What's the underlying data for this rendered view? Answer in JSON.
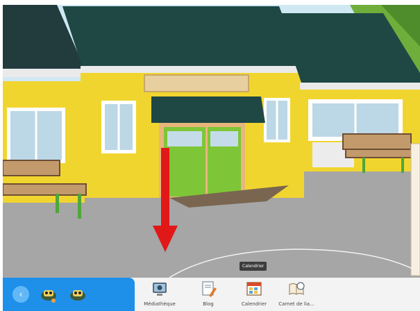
{
  "tooltip": {
    "text": "Calendrier"
  },
  "dock": {
    "back_icon": "chevron-left-icon",
    "characters": [
      "character-icon",
      "character-icon"
    ],
    "items": [
      {
        "label": "Médiathèque",
        "icon": "media-library-icon"
      },
      {
        "label": "Blog",
        "icon": "blog-icon"
      },
      {
        "label": "Calendrier",
        "icon": "calendar-icon"
      },
      {
        "label": "Carnet de lia...",
        "icon": "notebook-icon"
      }
    ]
  },
  "colors": {
    "dock_blue": "#1e90ea",
    "building_yellow": "#f5dc36",
    "roof": "#1f4845",
    "door_green": "#7ec637",
    "arrow": "#e01818"
  }
}
